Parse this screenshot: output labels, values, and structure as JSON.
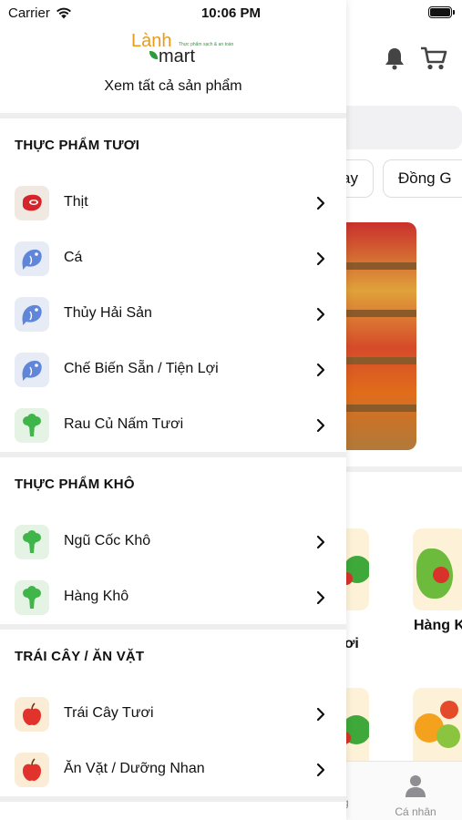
{
  "status_bar": {
    "carrier": "Carrier",
    "time": "10:06 PM"
  },
  "logo": {
    "word1": "Lành",
    "word2": "mart",
    "tagline": "Thực phẩm sạch & an toàn"
  },
  "drawer": {
    "view_all": "Xem tất cả sản phẩm",
    "sections": [
      {
        "title": "THỰC PHẨM TƯƠI",
        "items": [
          {
            "label": "Thịt",
            "icon": "meat-icon"
          },
          {
            "label": "Cá",
            "icon": "fish-icon"
          },
          {
            "label": "Thủy Hải Sản",
            "icon": "fish-icon"
          },
          {
            "label": "Chế Biến Sẵn / Tiện Lợi",
            "icon": "fish-icon"
          },
          {
            "label": "Rau Củ Nấm Tươi",
            "icon": "broccoli-icon"
          }
        ]
      },
      {
        "title": "THỰC PHẨM KHÔ",
        "items": [
          {
            "label": "Ngũ Cốc Khô",
            "icon": "broccoli-icon"
          },
          {
            "label": "Hàng Khô",
            "icon": "broccoli-icon"
          }
        ]
      },
      {
        "title": "TRÁI CÂY / ĂN VẶT",
        "items": [
          {
            "label": "Trái Cây Tươi",
            "icon": "apple-icon"
          },
          {
            "label": "Ăn Vặt / Dưỡng Nhan",
            "icon": "apple-icon"
          }
        ]
      }
    ]
  },
  "background": {
    "chips": [
      "ay",
      "Đồng G"
    ],
    "category_partial": "Hàng K",
    "category_partial_2": "ơi",
    "tab_profile": "Cá nhân",
    "tab_partial": "g"
  },
  "colors": {
    "brand_orange": "#e89a1c",
    "brand_green": "#2e9b3d",
    "meat_red": "#d6252a",
    "fish_blue": "#5f86d8",
    "veg_green": "#3fb54a",
    "apple_red": "#e1322c"
  }
}
